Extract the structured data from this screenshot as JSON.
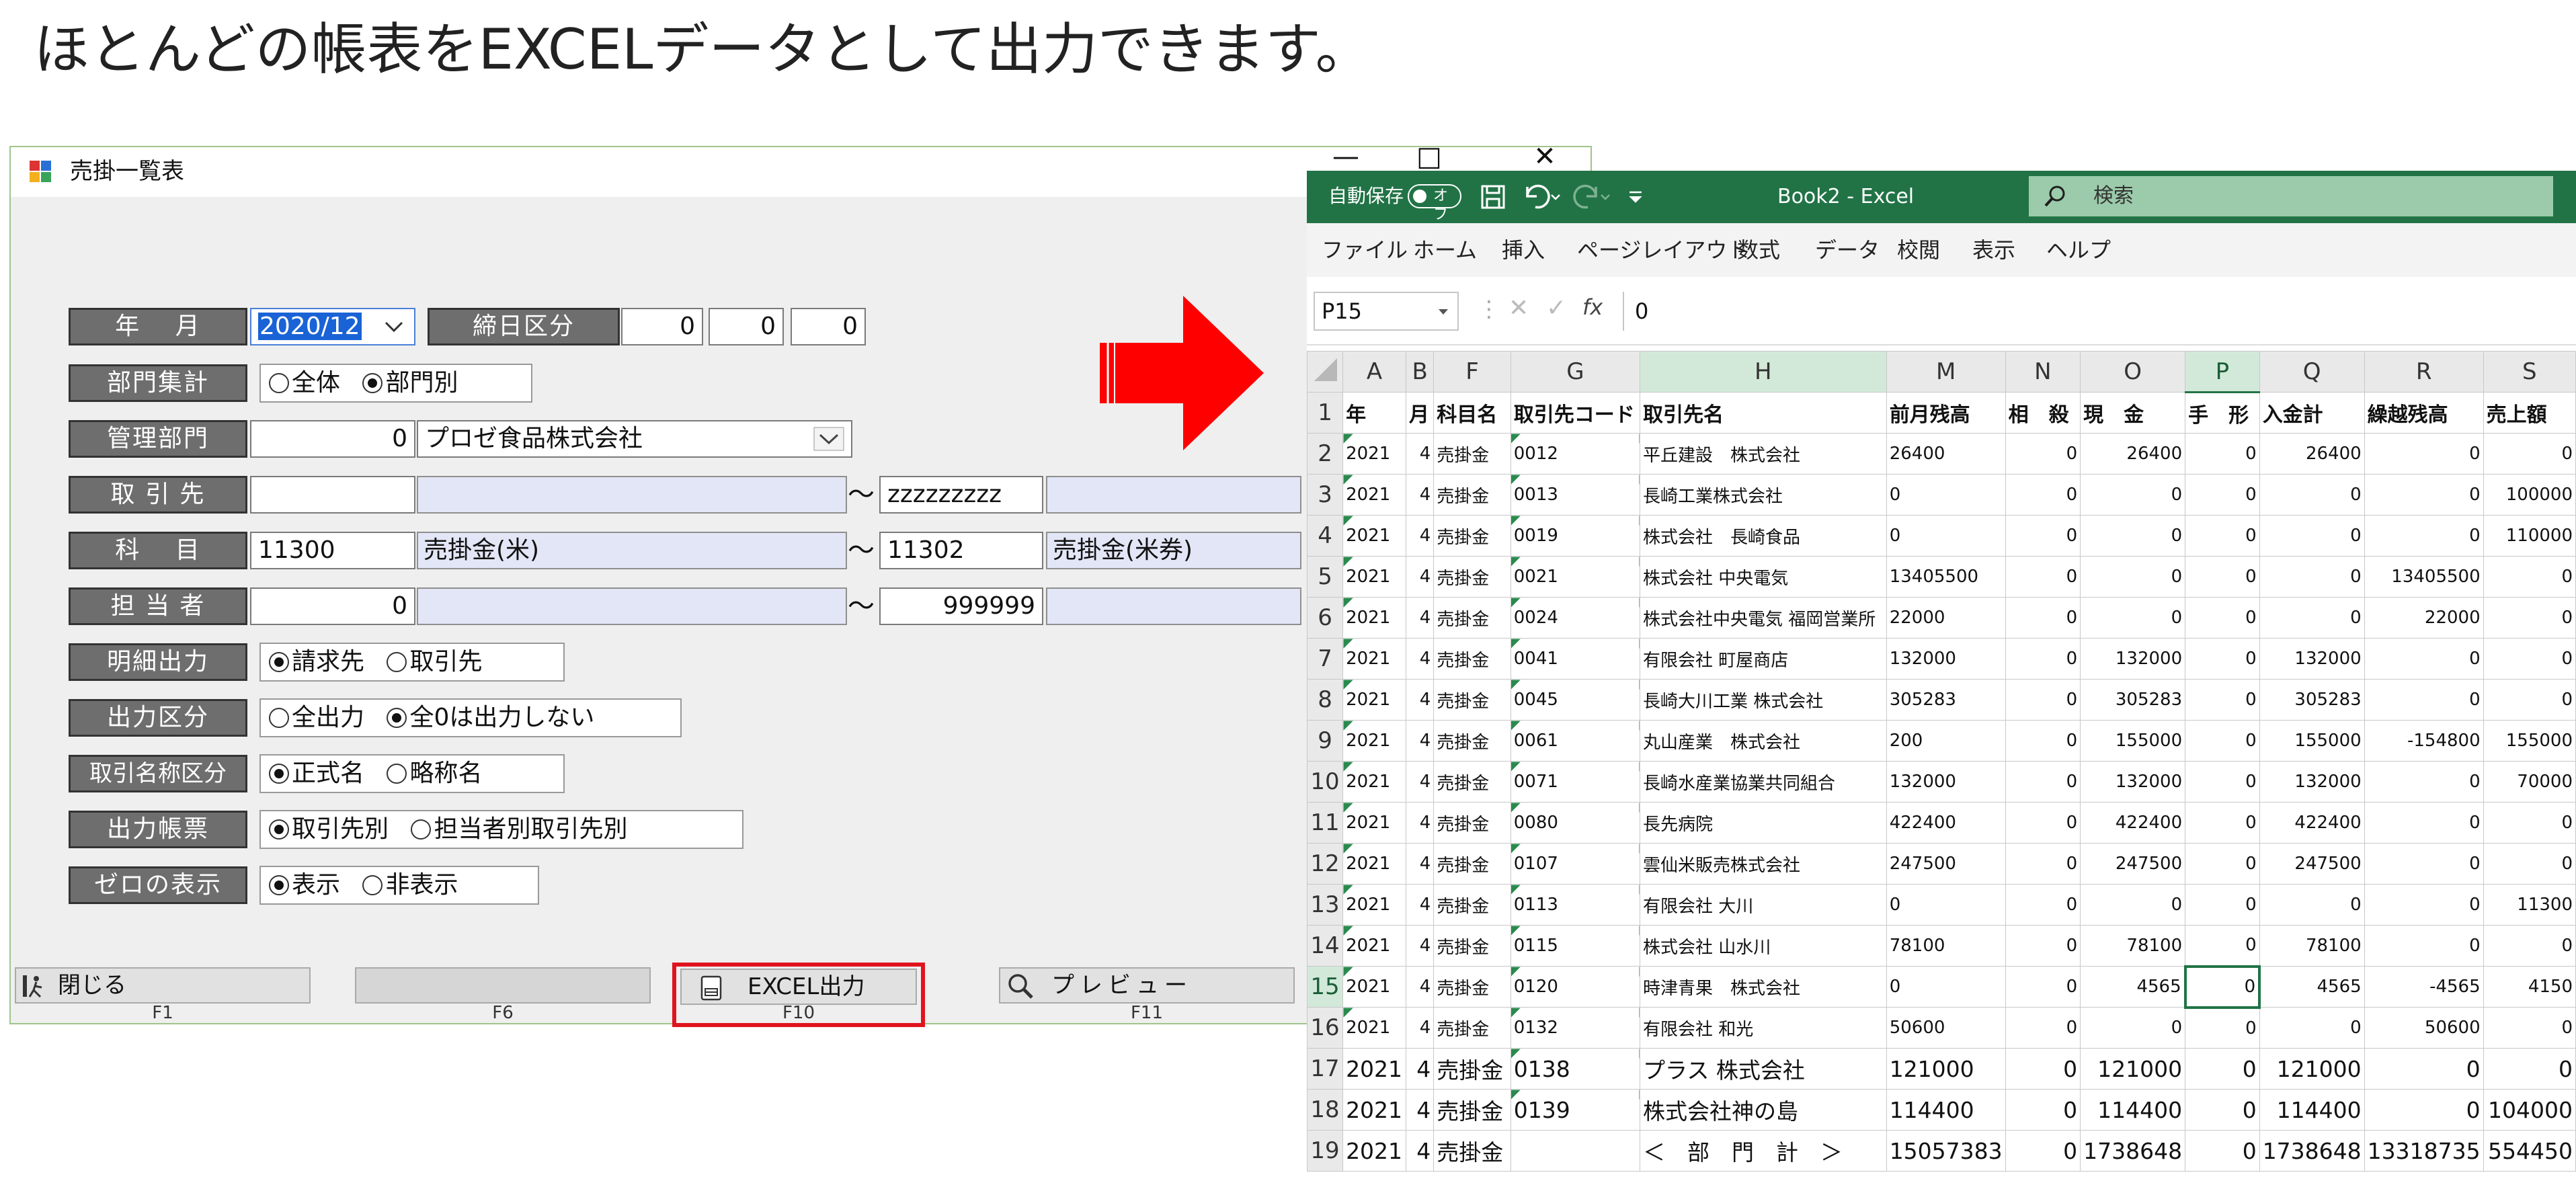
{
  "caption": "ほとんどの帳表をEXCELデータとして出力できます。",
  "form": {
    "title": "売掛一覧表",
    "window_controls": [
      "—",
      "□",
      "✕"
    ],
    "year_month_label": "年　 月",
    "year_month_value": "2020/12",
    "closing_label": "締日区分",
    "closing_values": [
      "0",
      "0",
      "0"
    ],
    "dept_sum_label": "部門集計",
    "dept_sum_options": [
      "全体",
      "部門別"
    ],
    "dept_sum_selected": 1,
    "mgmt_dept_label": "管理部門",
    "mgmt_dept_code": "0",
    "mgmt_dept_name": "プロゼ食品株式会社",
    "customer_label": "取 引 先",
    "customer_from": "",
    "customer_to": "zzzzzzzzz",
    "subject_label": "科　 目",
    "subject_from": "11300",
    "subject_from_name": "売掛金(米)",
    "subject_to": "11302",
    "subject_to_name": "売掛金(米券)",
    "staff_label": "担 当 者",
    "staff_from": "0",
    "staff_to": "999999",
    "tilde": "～",
    "detail_label": "明細出力",
    "detail_options": [
      "請求先",
      "取引先"
    ],
    "detail_selected": 0,
    "output_label": "出力区分",
    "output_options": [
      "全出力",
      "全0は出力しない"
    ],
    "output_selected": 1,
    "name_label": "取引名称区分",
    "name_options": [
      "正式名",
      "略称名"
    ],
    "name_selected": 0,
    "report_label": "出力帳票",
    "report_options": [
      "取引先別",
      "担当者別取引先別"
    ],
    "report_selected": 0,
    "zero_label": "ゼロの表示",
    "zero_options": [
      "表示",
      "非表示"
    ],
    "zero_selected": 0,
    "fkeys": [
      {
        "label": "閉じる",
        "key": "F1"
      },
      {
        "label": "",
        "key": "F6"
      },
      {
        "label": "EXCEL出力",
        "key": "F10"
      },
      {
        "label": "プレビュー",
        "key": "F11"
      }
    ]
  },
  "colors": {
    "excel_green": "#217346",
    "arrow_red": "#ff0000",
    "highlight_box": "#e0141e",
    "label_gray": "#6e6e6e"
  },
  "excel": {
    "autosave": "自動保存",
    "autosave_state": "オフ",
    "title": "Book2 - Excel",
    "search_placeholder": "検索",
    "menu": [
      "ファイル",
      "ホーム",
      "挿入",
      "ページレイアウト",
      "数式",
      "データ",
      "校閲",
      "表示",
      "ヘルプ"
    ],
    "name_box": "P15",
    "fx": "fx",
    "formula_value": "0",
    "columns": [
      "A",
      "B",
      "F",
      "G",
      "H",
      "M",
      "N",
      "O",
      "P",
      "Q",
      "R",
      "S"
    ],
    "selected_column": "P",
    "rows": [
      [
        "1",
        "年",
        "月",
        "科目名",
        "取引先コード",
        "取引先名",
        "前月残高",
        "相　殺",
        "現　金",
        "手　形",
        "入金計",
        "繰越残高",
        "売上額"
      ],
      [
        "2",
        "2021",
        "4",
        "売掛金",
        "0012",
        "平丘建設　株式会社",
        "26400",
        "0",
        "26400",
        "0",
        "26400",
        "0",
        "0"
      ],
      [
        "3",
        "2021",
        "4",
        "売掛金",
        "0013",
        "長崎工業株式会社",
        "0",
        "0",
        "0",
        "0",
        "0",
        "0",
        "100000"
      ],
      [
        "4",
        "2021",
        "4",
        "売掛金",
        "0019",
        "株式会社　長崎食品",
        "0",
        "0",
        "0",
        "0",
        "0",
        "0",
        "110000"
      ],
      [
        "5",
        "2021",
        "4",
        "売掛金",
        "0021",
        "株式会社 中央電気",
        "13405500",
        "0",
        "0",
        "0",
        "0",
        "13405500",
        "0"
      ],
      [
        "6",
        "2021",
        "4",
        "売掛金",
        "0024",
        "株式会社中央電気 福岡営業所",
        "22000",
        "0",
        "0",
        "0",
        "0",
        "22000",
        "0"
      ],
      [
        "7",
        "2021",
        "4",
        "売掛金",
        "0041",
        "有限会社 町屋商店",
        "132000",
        "0",
        "132000",
        "0",
        "132000",
        "0",
        "0"
      ],
      [
        "8",
        "2021",
        "4",
        "売掛金",
        "0045",
        "長崎大川工業 株式会社",
        "305283",
        "0",
        "305283",
        "0",
        "305283",
        "0",
        "0"
      ],
      [
        "9",
        "2021",
        "4",
        "売掛金",
        "0061",
        "丸山産業　株式会社",
        "200",
        "0",
        "155000",
        "0",
        "155000",
        "-154800",
        "155000"
      ],
      [
        "10",
        "2021",
        "4",
        "売掛金",
        "0071",
        "長崎水産業協業共同組合",
        "132000",
        "0",
        "132000",
        "0",
        "132000",
        "0",
        "70000"
      ],
      [
        "11",
        "2021",
        "4",
        "売掛金",
        "0080",
        "長先病院",
        "422400",
        "0",
        "422400",
        "0",
        "422400",
        "0",
        "0"
      ],
      [
        "12",
        "2021",
        "4",
        "売掛金",
        "0107",
        "雲仙米販売株式会社",
        "247500",
        "0",
        "247500",
        "0",
        "247500",
        "0",
        "0"
      ],
      [
        "13",
        "2021",
        "4",
        "売掛金",
        "0113",
        "有限会社 大川",
        "0",
        "0",
        "0",
        "0",
        "0",
        "0",
        "11300"
      ],
      [
        "14",
        "2021",
        "4",
        "売掛金",
        "0115",
        "株式会社 山水川",
        "78100",
        "0",
        "78100",
        "0",
        "78100",
        "0",
        "0"
      ],
      [
        "15",
        "2021",
        "4",
        "売掛金",
        "0120",
        "時津青果　株式会社",
        "0",
        "0",
        "4565",
        "0",
        "4565",
        "-4565",
        "4150"
      ],
      [
        "16",
        "2021",
        "4",
        "売掛金",
        "0132",
        "有限会社 和光",
        "50600",
        "0",
        "0",
        "0",
        "0",
        "50600",
        "0"
      ],
      [
        "17",
        "2021",
        "4",
        "売掛金",
        "0138",
        "プラス 株式会社",
        "121000",
        "0",
        "121000",
        "0",
        "121000",
        "0",
        "0"
      ],
      [
        "18",
        "2021",
        "4",
        "売掛金",
        "0139",
        "株式会社神の島",
        "114400",
        "0",
        "114400",
        "0",
        "114400",
        "0",
        "104000"
      ],
      [
        "19",
        "2021",
        "4",
        "売掛金",
        "",
        "＜　部　門　計　＞",
        "15057383",
        "0",
        "1738648",
        "0",
        "1738648",
        "13318735",
        "554450"
      ]
    ]
  }
}
